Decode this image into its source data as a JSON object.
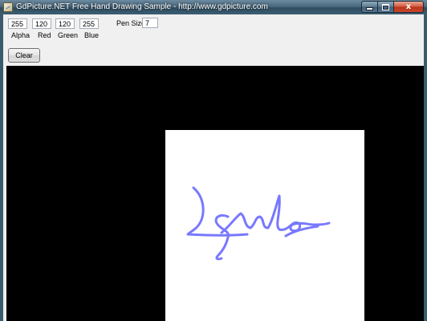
{
  "window": {
    "title": "GdPicture.NET Free Hand Drawing Sample - http://www.gdpicture.com",
    "caption_buttons": {
      "minimize": "",
      "maximize": "",
      "close": "x"
    }
  },
  "color_fields": [
    {
      "label": "Alpha",
      "value": "255"
    },
    {
      "label": "Red",
      "value": "120"
    },
    {
      "label": "Green",
      "value": "120"
    },
    {
      "label": "Blue",
      "value": "255"
    }
  ],
  "pen_size": {
    "label": "Pen Size:",
    "value": "7"
  },
  "clear_button": {
    "label": "Clear"
  },
  "drawing": {
    "stroke_color": "#7878ff",
    "page_color": "#ffffff",
    "background_color": "#000000"
  }
}
